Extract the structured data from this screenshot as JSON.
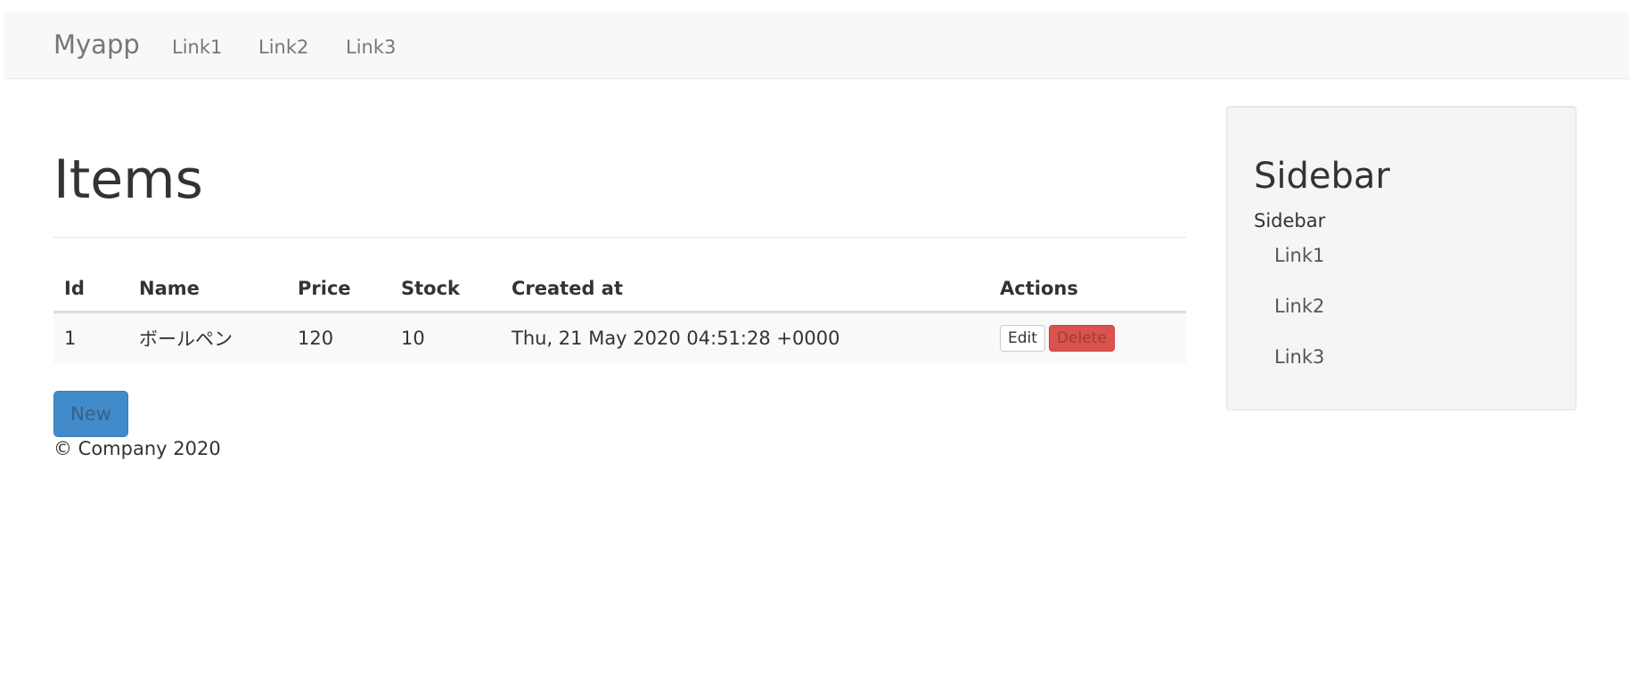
{
  "navbar": {
    "brand": "Myapp",
    "links": [
      "Link1",
      "Link2",
      "Link3"
    ]
  },
  "main": {
    "title": "Items",
    "table": {
      "headers": [
        "Id",
        "Name",
        "Price",
        "Stock",
        "Created at",
        "Actions"
      ],
      "rows": [
        {
          "id": "1",
          "name": "ボールペン",
          "price": "120",
          "stock": "10",
          "created_at": "Thu, 21 May 2020 04:51:28 +0000",
          "actions": {
            "edit": "Edit",
            "delete": "Delete"
          }
        }
      ]
    },
    "new_button": "New"
  },
  "footer": {
    "text": "© Company 2020"
  },
  "sidebar": {
    "title": "Sidebar",
    "subtitle": "Sidebar",
    "links": [
      "Link1",
      "Link2",
      "Link3"
    ]
  },
  "colors": {
    "navbar_bg": "#f8f8f8",
    "primary": "#428bca",
    "danger": "#d9534f",
    "sidebar_bg": "#f5f5f5"
  }
}
